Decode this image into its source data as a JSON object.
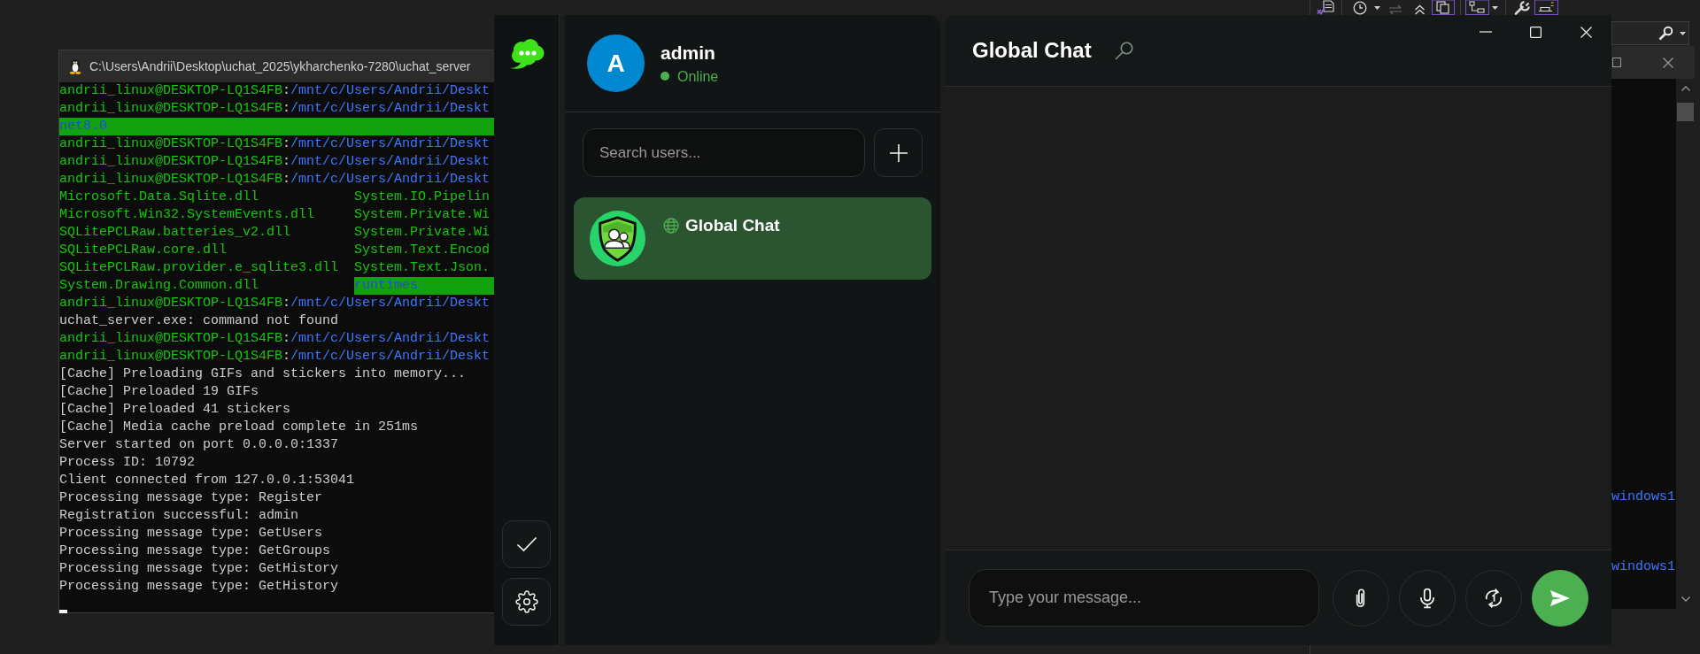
{
  "terminal": {
    "title": "C:\\Users\\Andrii\\Desktop\\uchat_2025\\ykharchenko-7280\\uchat_server",
    "lines": [
      {
        "kind": "prompt",
        "user": "andrii_linux@DESKTOP-LQ1S4FB",
        "separator": ":",
        "path": "/mnt/c/Users/Andrii/Deskt"
      },
      {
        "kind": "prompt",
        "user": "andrii_linux@DESKTOP-LQ1S4FB",
        "separator": ":",
        "path": "/mnt/c/Users/Andrii/Deskt"
      },
      {
        "kind": "files",
        "cells": [
          {
            "text": "net8.0",
            "highlight": true
          }
        ]
      },
      {
        "kind": "prompt",
        "user": "andrii_linux@DESKTOP-LQ1S4FB",
        "separator": ":",
        "path": "/mnt/c/Users/Andrii/Deskt"
      },
      {
        "kind": "prompt",
        "user": "andrii_linux@DESKTOP-LQ1S4FB",
        "separator": ":",
        "path": "/mnt/c/Users/Andrii/Deskt"
      },
      {
        "kind": "prompt",
        "user": "andrii_linux@DESKTOP-LQ1S4FB",
        "separator": ":",
        "path": "/mnt/c/Users/Andrii/Deskt"
      },
      {
        "kind": "files",
        "cells": [
          {
            "text": "Microsoft.Data.Sqlite.dll",
            "highlight": false
          },
          {
            "text": "System.IO.Pipelin",
            "highlight": false
          }
        ]
      },
      {
        "kind": "files",
        "cells": [
          {
            "text": "Microsoft.Win32.SystemEvents.dll",
            "highlight": false
          },
          {
            "text": "System.Private.Wi",
            "highlight": false
          }
        ]
      },
      {
        "kind": "files",
        "cells": [
          {
            "text": "SQLitePCLRaw.batteries_v2.dll",
            "highlight": false
          },
          {
            "text": "System.Private.Wi",
            "highlight": false
          }
        ]
      },
      {
        "kind": "files",
        "cells": [
          {
            "text": "SQLitePCLRaw.core.dll",
            "highlight": false
          },
          {
            "text": "System.Text.Encod",
            "highlight": false
          }
        ]
      },
      {
        "kind": "files",
        "cells": [
          {
            "text": "SQLitePCLRaw.provider.e_sqlite3.dll",
            "highlight": false
          },
          {
            "text": "System.Text.Json.",
            "highlight": false
          }
        ]
      },
      {
        "kind": "files",
        "cells": [
          {
            "text": "System.Drawing.Common.dll",
            "highlight": false
          },
          {
            "text": "runtimes",
            "highlight": true
          }
        ]
      },
      {
        "kind": "prompt",
        "user": "andrii_linux@DESKTOP-LQ1S4FB",
        "separator": ":",
        "path": "/mnt/c/Users/Andrii/Deskt"
      },
      {
        "kind": "output",
        "text": "uchat_server.exe: command not found"
      },
      {
        "kind": "prompt",
        "user": "andrii_linux@DESKTOP-LQ1S4FB",
        "separator": ":",
        "path": "/mnt/c/Users/Andrii/Deskt"
      },
      {
        "kind": "prompt",
        "user": "andrii_linux@DESKTOP-LQ1S4FB",
        "separator": ":",
        "path": "/mnt/c/Users/Andrii/Deskt"
      },
      {
        "kind": "output",
        "text": "[Cache] Preloading GIFs and stickers into memory..."
      },
      {
        "kind": "output",
        "text": "[Cache] Preloaded 19 GIFs"
      },
      {
        "kind": "output",
        "text": "[Cache] Preloaded 41 stickers"
      },
      {
        "kind": "output",
        "text": "[Cache] Media cache preload complete in 251ms"
      },
      {
        "kind": "output",
        "text": "Server started on port 0.0.0.0:1337"
      },
      {
        "kind": "output",
        "text": "Process ID: 10792"
      },
      {
        "kind": "output",
        "text": "Client connected from 127.0.0.1:53041"
      },
      {
        "kind": "output",
        "text": "Processing message type: Register"
      },
      {
        "kind": "output",
        "text": "Registration successful: admin"
      },
      {
        "kind": "output",
        "text": "Processing message type: GetUsers"
      },
      {
        "kind": "output",
        "text": "Processing message type: GetGroups"
      },
      {
        "kind": "output",
        "text": "Processing message type: GetHistory"
      },
      {
        "kind": "output",
        "text": "Processing message type: GetHistory"
      }
    ],
    "cursor": true
  },
  "app": {
    "profile": {
      "avatar_letter": "A",
      "name": "admin",
      "status": "Online",
      "online": true
    },
    "search": {
      "placeholder": "Search users..."
    },
    "chats": [
      {
        "name": "Global Chat",
        "selected": true
      }
    ],
    "chat": {
      "title": "Global Chat"
    },
    "composer": {
      "placeholder": "Type your message..."
    }
  },
  "ide": {
    "output_lines": [
      "windows1",
      "windows1"
    ]
  }
}
